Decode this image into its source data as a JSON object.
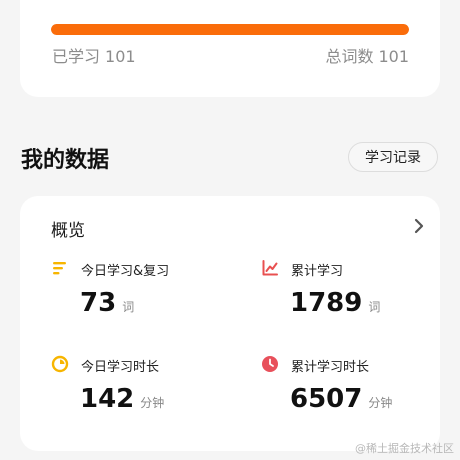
{
  "progress": {
    "learned_label": "已学习",
    "learned_count": "101",
    "total_label": "总词数",
    "total_count": "101",
    "fill_fraction": 1.0,
    "fill_color": "#fa6c0a"
  },
  "section": {
    "title": "我的数据",
    "records_button": "学习记录"
  },
  "overview": {
    "title": "概览",
    "stats": [
      {
        "label": "今日学习&复习",
        "value": "73",
        "unit": "词",
        "icon": "lines-icon",
        "icon_color": "#f7b500"
      },
      {
        "label": "累计学习",
        "value": "1789",
        "unit": "词",
        "icon": "trend-chart-icon",
        "icon_color": "#e85050"
      },
      {
        "label": "今日学习时长",
        "value": "142",
        "unit": "分钟",
        "icon": "pie-clock-icon",
        "icon_color": "#f7b500"
      },
      {
        "label": "累计学习时长",
        "value": "6507",
        "unit": "分钟",
        "icon": "clock-icon",
        "icon_color": "#e8505b"
      }
    ]
  },
  "watermark": "@稀土掘金技术社区"
}
